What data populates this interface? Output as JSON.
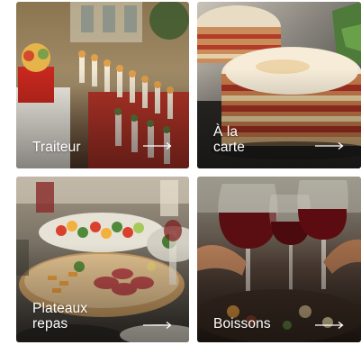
{
  "tiles": [
    {
      "label": "Traiteur",
      "arrow_icon": "arrow-right-icon"
    },
    {
      "label": "À la\ncarte",
      "arrow_icon": "arrow-right-icon"
    },
    {
      "label": "Plateaux\nrepas",
      "arrow_icon": "arrow-right-icon"
    },
    {
      "label": "Boissons",
      "arrow_icon": "arrow-right-icon"
    }
  ],
  "colors": {
    "label_text": "#ffffff",
    "traiteur_bg": "#6f5b3e",
    "carte_bg": "#3e3a37",
    "plateaux_bg": "#4a4a44",
    "boissons_bg": "#3b2a24"
  }
}
